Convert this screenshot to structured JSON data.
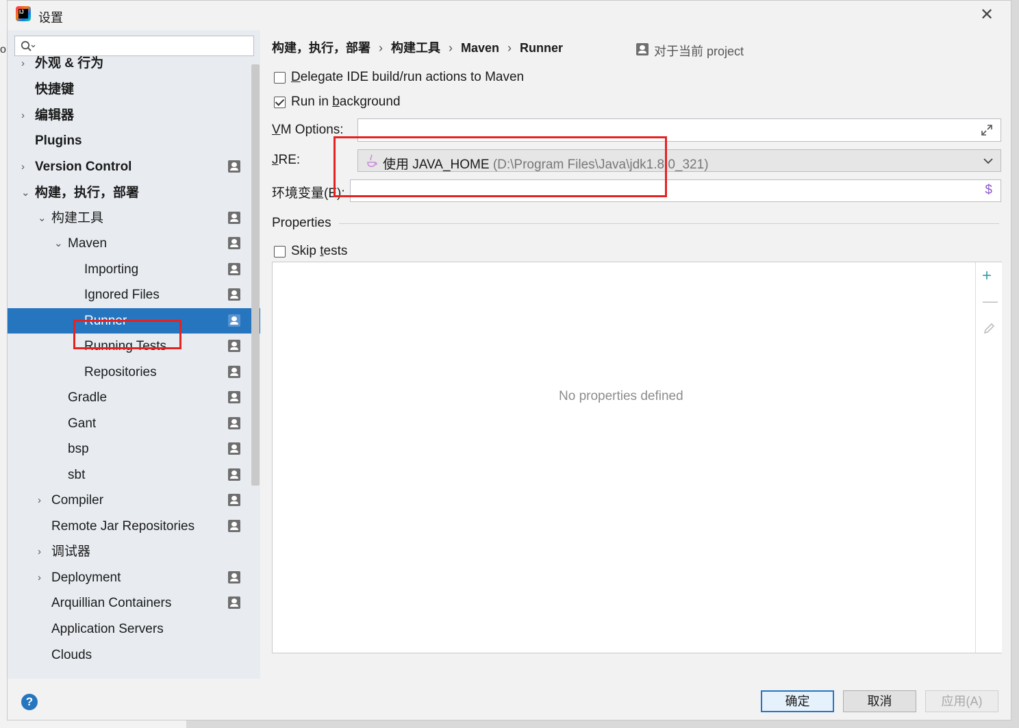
{
  "window": {
    "title": "设置",
    "stub_text": "o"
  },
  "search": {
    "placeholder": ""
  },
  "tree": [
    {
      "label": "外观 & 行为",
      "arrow": "›",
      "bold": true,
      "project": false
    },
    {
      "label": "快捷键",
      "arrow": "",
      "bold": true,
      "project": false
    },
    {
      "label": "编辑器",
      "arrow": "›",
      "bold": true,
      "project": false
    },
    {
      "label": "Plugins",
      "arrow": "",
      "bold": true,
      "project": false
    },
    {
      "label": "Version Control",
      "arrow": "›",
      "bold": true,
      "project": true
    },
    {
      "label": "构建，执行，部署",
      "arrow": "⌄",
      "bold": true,
      "project": false
    },
    {
      "label": "构建工具",
      "arrow": "⌄",
      "bold": false,
      "project": true
    },
    {
      "label": "Maven",
      "arrow": "⌄",
      "bold": false,
      "project": true
    },
    {
      "label": "Importing",
      "arrow": "",
      "bold": false,
      "project": true
    },
    {
      "label": "Ignored Files",
      "arrow": "",
      "bold": false,
      "project": true
    },
    {
      "label": "Runner",
      "arrow": "",
      "bold": false,
      "project": true,
      "selected": true
    },
    {
      "label": "Running Tests",
      "arrow": "",
      "bold": false,
      "project": true
    },
    {
      "label": "Repositories",
      "arrow": "",
      "bold": false,
      "project": true
    },
    {
      "label": "Gradle",
      "arrow": "",
      "bold": false,
      "project": true
    },
    {
      "label": "Gant",
      "arrow": "",
      "bold": false,
      "project": true
    },
    {
      "label": "bsp",
      "arrow": "",
      "bold": false,
      "project": true
    },
    {
      "label": "sbt",
      "arrow": "",
      "bold": false,
      "project": true
    },
    {
      "label": "Compiler",
      "arrow": "›",
      "bold": false,
      "project": true
    },
    {
      "label": "Remote Jar Repositories",
      "arrow": "",
      "bold": false,
      "project": true
    },
    {
      "label": "调试器",
      "arrow": "›",
      "bold": false,
      "project": false
    },
    {
      "label": "Deployment",
      "arrow": "›",
      "bold": false,
      "project": true
    },
    {
      "label": "Arquillian Containers",
      "arrow": "",
      "bold": false,
      "project": true
    },
    {
      "label": "Application Servers",
      "arrow": "",
      "bold": false,
      "project": false
    },
    {
      "label": "Clouds",
      "arrow": "",
      "bold": false,
      "project": false
    }
  ],
  "breadcrumb": {
    "items": [
      "构建，执行，部署",
      "构建工具",
      "Maven",
      "Runner"
    ],
    "separator": "›"
  },
  "scope": {
    "label": "对于当前 project"
  },
  "options": {
    "delegate": {
      "label_first": "D",
      "label_rest": "elegate IDE build/run actions to Maven",
      "checked": false
    },
    "background": {
      "label_prefix": "Run in ",
      "label_underlined": "b",
      "label_rest": "ackground",
      "checked": true
    },
    "vm_options": {
      "label_first": "V",
      "label_rest": "M Options:",
      "value": ""
    },
    "jre": {
      "label_first": "J",
      "label_rest": "RE:",
      "value_main": "使用 JAVA_HOME",
      "value_path": "(D:\\Program Files\\Java\\jdk1.8.0_321)"
    },
    "env": {
      "label": "环境变量(E):",
      "value": ""
    },
    "properties_title": "Properties",
    "skip_tests": {
      "label_prefix": "Skip ",
      "label_underlined": "t",
      "label_rest": "ests",
      "checked": false
    },
    "empty_text": "No properties defined"
  },
  "buttons": {
    "ok": "确定",
    "cancel": "取消",
    "apply": "应用(A)",
    "help": "?"
  },
  "colors": {
    "selection": "#2675bf",
    "highlight": "#e52222",
    "add_icon": "#3a9ea5",
    "dollar_icon": "#8e5ad1"
  }
}
